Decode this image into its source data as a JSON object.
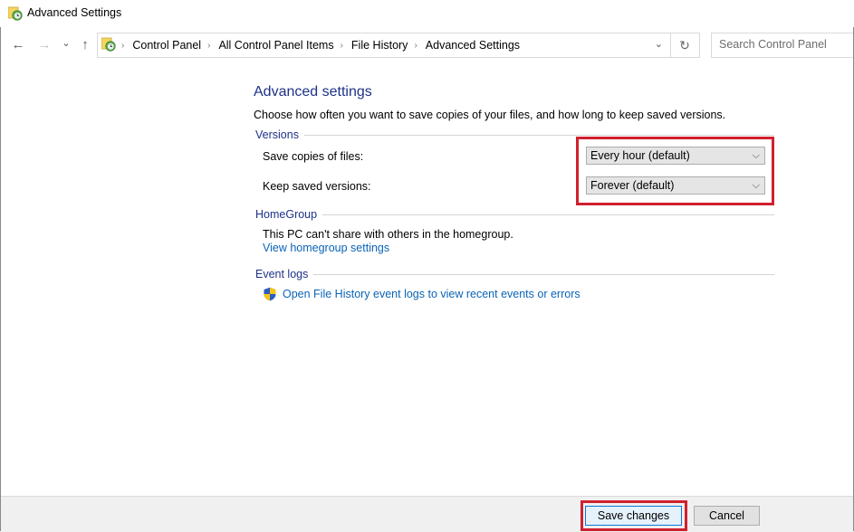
{
  "window": {
    "title": "Advanced Settings",
    "icon": "file-history-icon"
  },
  "nav": {
    "back_icon": "arrow-left-icon",
    "forward_icon": "arrow-right-icon",
    "recent_icon": "chevron-down-icon",
    "up_icon": "arrow-up-icon",
    "back_glyph": "←",
    "forward_glyph": "→",
    "recent_glyph": "⌄",
    "up_glyph": "↑",
    "breadcrumb": [
      "Control Panel",
      "All Control Panel Items",
      "File History",
      "Advanced Settings"
    ],
    "breadcrumb_sep": "›",
    "dropdown_glyph": "⌄",
    "refresh_glyph": "↻",
    "search_placeholder": "Search Control Panel"
  },
  "main": {
    "heading": "Advanced settings",
    "description": "Choose how often you want to save copies of your files, and how long to keep saved versions.",
    "versions": {
      "title": "Versions",
      "save_copies_label": "Save copies of files:",
      "save_copies_value": "Every hour (default)",
      "keep_versions_label": "Keep saved versions:",
      "keep_versions_value": "Forever (default)",
      "chevron": "⌵"
    },
    "homegroup": {
      "title": "HomeGroup",
      "status": "This PC can't share with others in the homegroup.",
      "link": "View homegroup settings"
    },
    "event_logs": {
      "title": "Event logs",
      "link": "Open File History event logs to view recent events or errors"
    }
  },
  "footer": {
    "save_label": "Save changes",
    "cancel_label": "Cancel"
  },
  "highlight_color": "#d0202e",
  "accent_color": "#1e3287",
  "link_color": "#0b64b5"
}
